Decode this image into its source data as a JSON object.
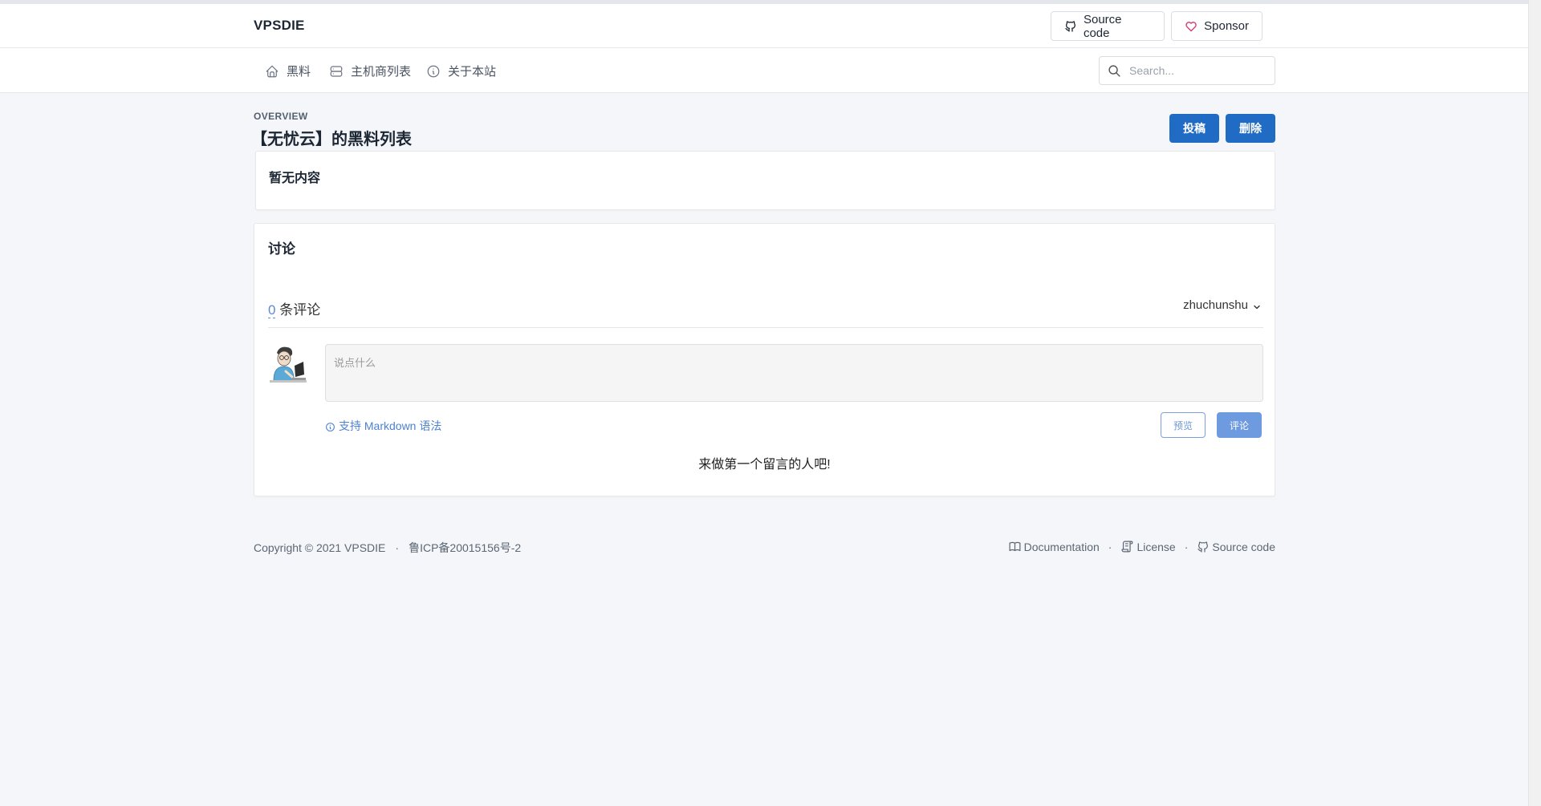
{
  "header": {
    "brand": "VPSDIE",
    "source_code_label": "Source code",
    "sponsor_label": "Sponsor"
  },
  "nav": {
    "items": [
      {
        "label": "黑料",
        "icon": "home-icon"
      },
      {
        "label": "主机商列表",
        "icon": "server-icon"
      },
      {
        "label": "关于本站",
        "icon": "info-circle-icon"
      }
    ],
    "search_placeholder": "Search..."
  },
  "page": {
    "overview_label": "OVERVIEW",
    "title": "【无忧云】的黑料列表",
    "submit_label": "投稿",
    "delete_label": "删除",
    "empty_text": "暂无内容"
  },
  "discussion": {
    "title": "讨论",
    "count": "0",
    "count_suffix": "条评论",
    "username": "zhuchunshu",
    "input_placeholder": "说点什么",
    "markdown_hint": "支持 Markdown 语法",
    "preview_label": "预览",
    "comment_label": "评论",
    "first_message": "来做第一个留言的人吧!"
  },
  "footer": {
    "copyright": "Copyright © 2021 VPSDIE",
    "icp": "鲁ICP备20015156号-2",
    "links": [
      {
        "label": "Documentation",
        "icon": "book-icon"
      },
      {
        "label": "License",
        "icon": "license-icon"
      },
      {
        "label": "Source code",
        "icon": "github-icon"
      }
    ]
  },
  "colors": {
    "primary": "#206bc4",
    "sponsor_heart": "#d6336c",
    "link_blue": "#4c82d0",
    "background": "#f4f6fa"
  }
}
